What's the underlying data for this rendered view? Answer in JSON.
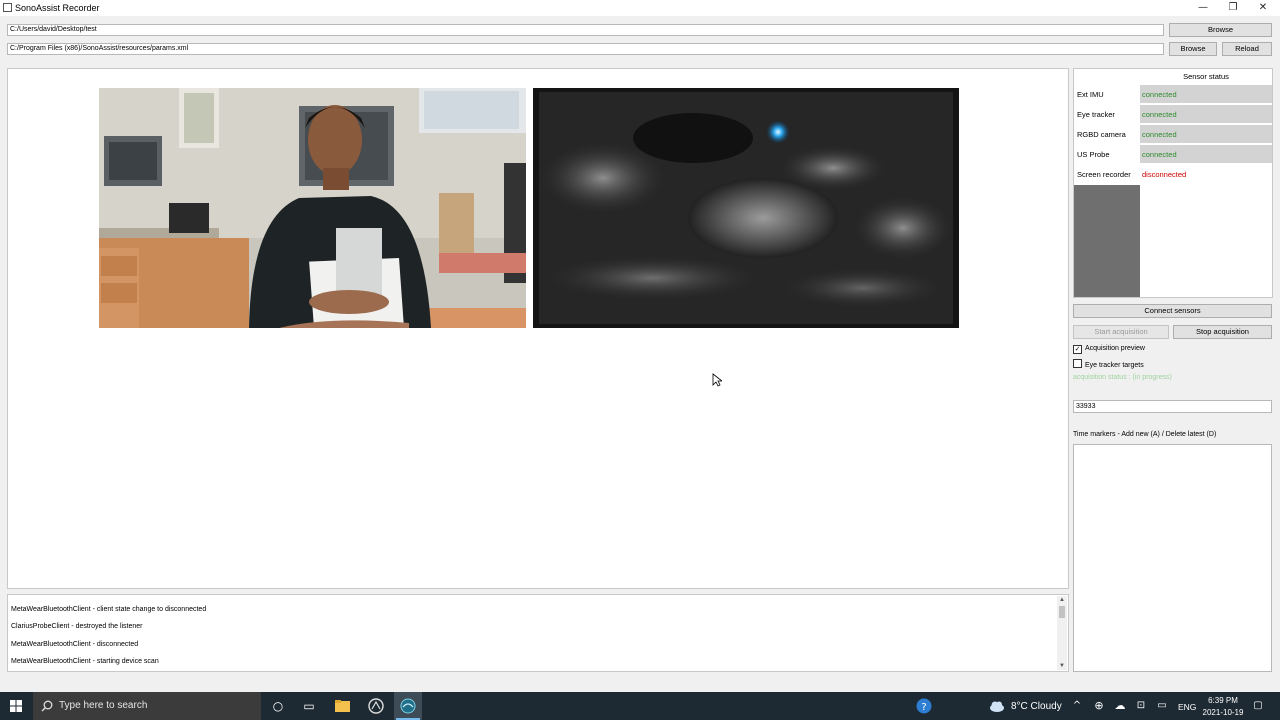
{
  "window": {
    "title": "SonoAssist Recorder",
    "minimize": "—",
    "maximize": "❐",
    "close": "✕"
  },
  "paths": {
    "output_folder": "C:/Users/david/Desktop/test",
    "params_file": "C:/Program Files (x86)/SonoAssist/resources/params.xml",
    "browse_label": "Browse",
    "reload_label": "Reload"
  },
  "sensor_status": {
    "header": "Sensor status",
    "rows": [
      {
        "name": "Ext IMU",
        "status": "connected"
      },
      {
        "name": "Eye tracker",
        "status": "connected"
      },
      {
        "name": "RGBD camera",
        "status": "connected"
      },
      {
        "name": "US Probe",
        "status": "connected"
      },
      {
        "name": "Screen recorder",
        "status": "disconnected"
      }
    ],
    "colors": {
      "connected": "#2e8b2e",
      "disconnected": "#cc0000"
    }
  },
  "controls": {
    "connect_sensors": "Connect sensors",
    "start_acquisition": "Start acquisition",
    "stop_acquisition": "Stop acquisition",
    "acquisition_preview": "Acquisition preview",
    "acquisition_preview_checked": true,
    "eye_tracker_targets": "Eye tracker targets",
    "eye_tracker_targets_checked": false,
    "acquisition_status": "acquisition status : (in progress)",
    "frame_counter": "33933",
    "time_markers_label": "Time markers - Add new (A) / Delete latest (D)"
  },
  "log": {
    "lines": [
      "MetaWearBluetoothClient - client state change to disconnected",
      "ClariusProbeClient - destroyed the listener",
      "MetaWearBluetoothClient - disconnected",
      "MetaWearBluetoothClient - starting device scan"
    ]
  },
  "taskbar": {
    "search_placeholder": "Type here to search",
    "weather": "8°C  Cloudy",
    "language": "ENG",
    "time": "6:39 PM",
    "date": "2021-10-19"
  }
}
